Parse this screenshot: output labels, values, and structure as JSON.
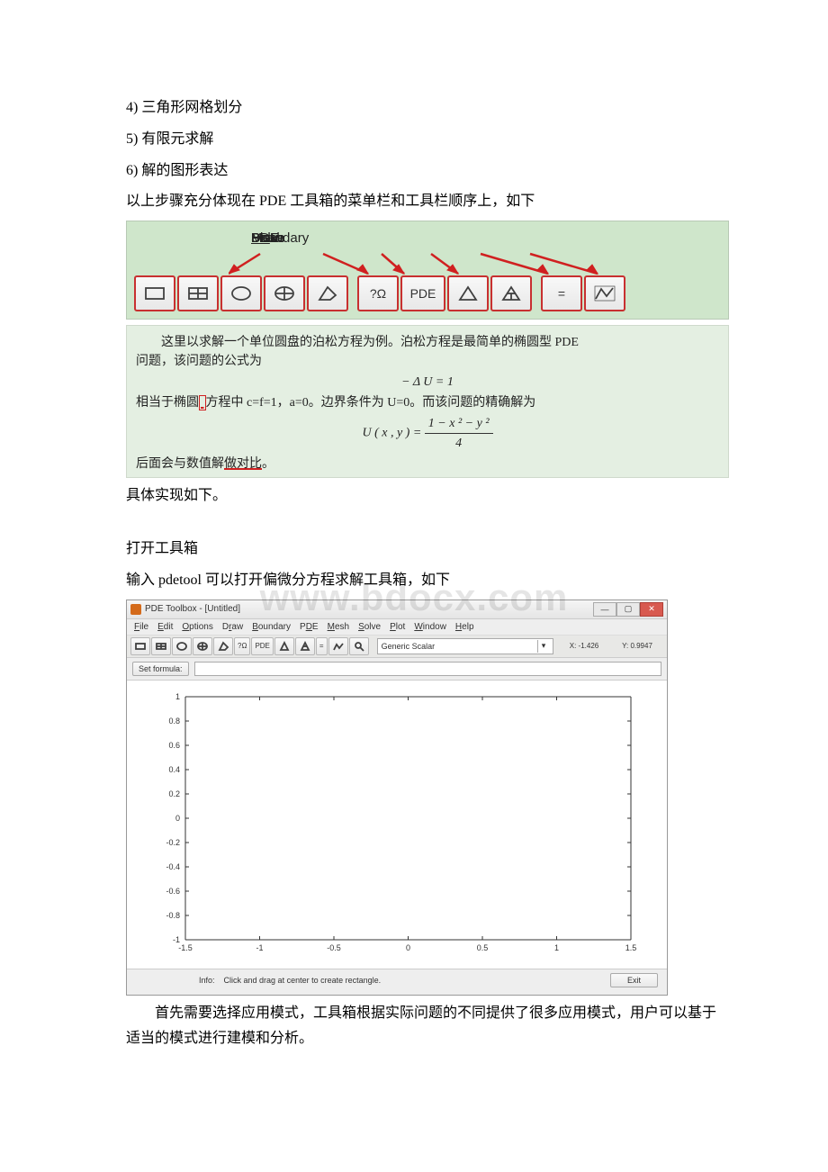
{
  "text": {
    "p1": "4) 三角形网格划分",
    "p2": "5) 有限元求解",
    "p3": "6) 解的图形表达",
    "p4": "以上步骤充分体现在 PDE 工具箱的菜单栏和工具栏顺序上，如下",
    "p5": "具体实现如下。",
    "p6": "打开工具箱",
    "p7": "输入 pdetool 可以打开偏微分方程求解工具箱，如下",
    "p8": "首先需要选择应用模式，工具箱根据实际问题的不同提供了很多应用模式，用户可以基于适当的模式进行建模和分析。"
  },
  "watermark": "www.bdocx.com",
  "fig1": {
    "menu": {
      "draw": "Draw",
      "boundary": "Boundary",
      "pde": "PDE",
      "mesh": "Mesh",
      "solve": "Solve",
      "plot": "Plot"
    },
    "toolbar": {
      "domega": "?Ω",
      "pde": "PDE",
      "equals": "="
    }
  },
  "fig2": {
    "line1": "　　这里以求解一个单位圆盘的泊松方程为例。泊松方程是最简单的椭圆型 PDE",
    "line2": "问题，该问题的公式为",
    "eq1_lhs": "− Δ U  =  1",
    "line3a": "相当于椭圆",
    "line3b": "方程中 c=f=1，a=0。边界条件为 U=0。而该问题的精确解为",
    "eq2_pre": "U  ( x , y )  = ",
    "eq2_num": "1 − x ² − y ²",
    "eq2_den": "4",
    "line4a": "后面会与数值解",
    "line4b": "做对比",
    "line4c": "。"
  },
  "pdewin": {
    "title": "PDE Toolbox - [Untitled]",
    "menu": {
      "file": "File",
      "edit": "Edit",
      "options": "Options",
      "draw": "Draw",
      "boundary": "Boundary",
      "pde": "PDE",
      "mesh": "Mesh",
      "solve": "Solve",
      "plot": "Plot",
      "window": "Window",
      "help": "Help"
    },
    "toolbar": {
      "domega": "?Ω",
      "pde": "PDE",
      "eq": "="
    },
    "mode": "Generic Scalar",
    "coords": {
      "x_label": "X:",
      "x_val": "-1.426",
      "y_label": "Y:",
      "y_val": "0.9947"
    },
    "setformula": "Set formula:",
    "info_label": "Info:",
    "info_text": "Click and drag at center to create rectangle.",
    "exit": "Exit"
  },
  "chart_data": {
    "type": "scatter",
    "x": [],
    "y": [],
    "title": "",
    "xlabel": "",
    "ylabel": "",
    "xlim": [
      -1.5,
      1.5
    ],
    "ylim": [
      -1,
      1
    ],
    "xticks": [
      -1.5,
      -1,
      -0.5,
      0,
      0.5,
      1,
      1.5
    ],
    "yticks": [
      -1,
      -0.8,
      -0.6,
      -0.4,
      -0.2,
      0,
      0.2,
      0.4,
      0.6,
      0.8,
      1
    ]
  }
}
